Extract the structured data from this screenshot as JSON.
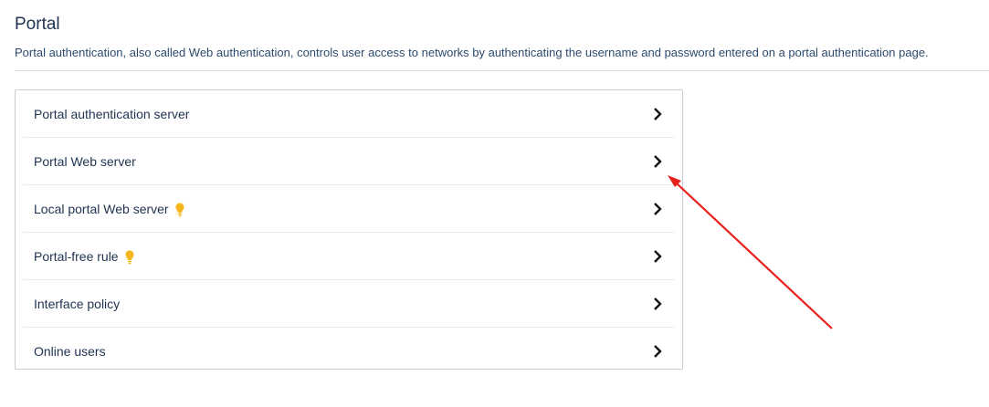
{
  "header": {
    "title": "Portal",
    "description": "Portal authentication, also called Web authentication, controls user access to networks by authenticating the username and password entered on a portal authentication page."
  },
  "menu": {
    "items": [
      {
        "label": "Portal authentication server",
        "has_tip": false
      },
      {
        "label": "Portal Web server",
        "has_tip": false
      },
      {
        "label": "Local portal Web server",
        "has_tip": true
      },
      {
        "label": "Portal-free rule",
        "has_tip": true
      },
      {
        "label": "Interface policy",
        "has_tip": false
      },
      {
        "label": "Online users",
        "has_tip": false
      }
    ]
  },
  "icons": {
    "tip": "lightbulb-icon",
    "navigate": "chevron-right-icon"
  },
  "colors": {
    "title": "#1f3250",
    "bulb": "#f5b61e",
    "annotation_arrow": "#e8201c"
  }
}
